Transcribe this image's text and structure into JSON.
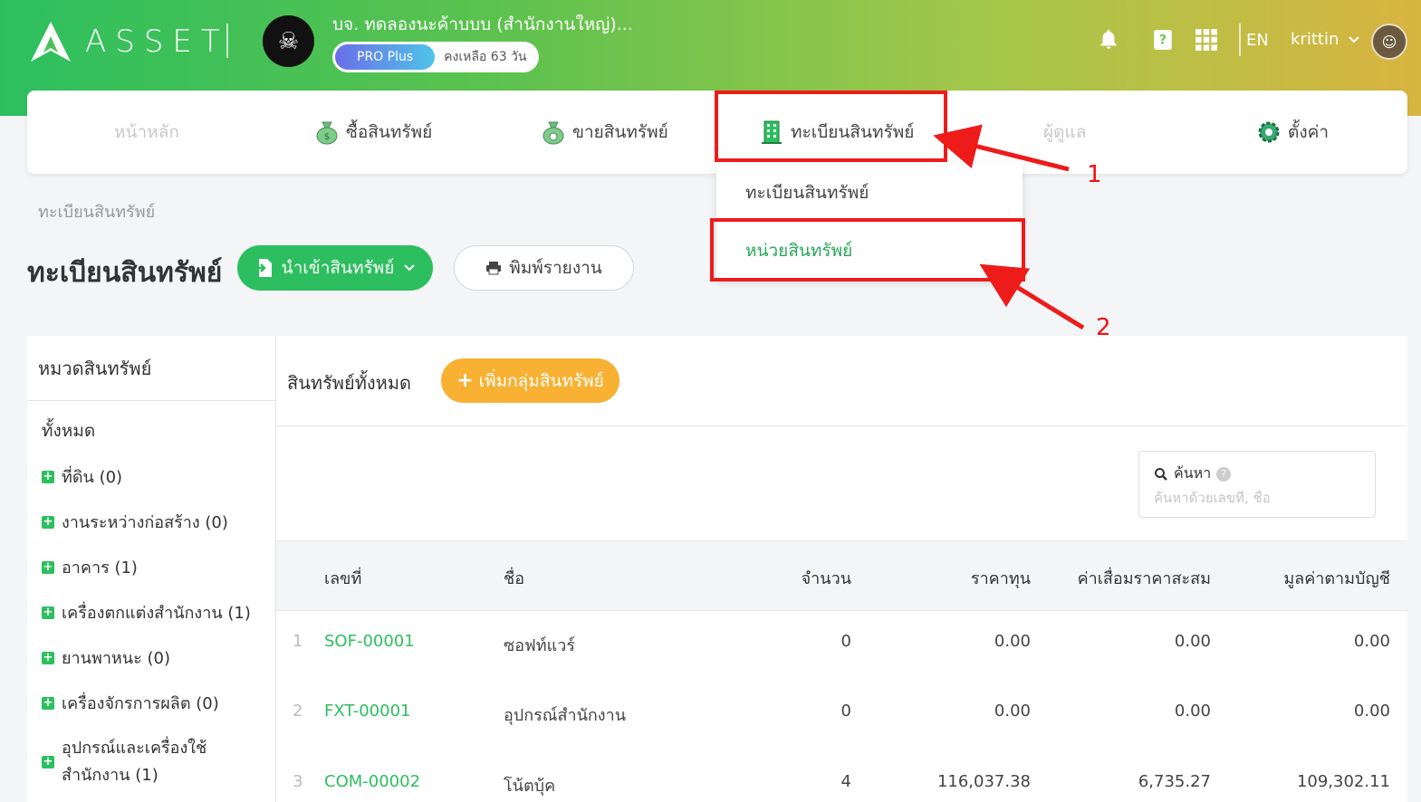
{
  "brand": {
    "logo_text": "ASSET"
  },
  "company": {
    "name": "บจ. ทดลองนะค้าบบบ (สำนักงานใหญ่)...",
    "plan": "PRO Plus",
    "remaining": "คงเหลือ 63 วัน"
  },
  "header": {
    "language": "EN",
    "username": "krittin"
  },
  "nav": {
    "home": "หน้าหลัก",
    "buy": "ซื้อสินทรัพย์",
    "sell": "ขายสินทรัพย์",
    "register": "ทะเบียนสินทรัพย์",
    "admin": "ผู้ดูแล",
    "settings": "ตั้งค่า"
  },
  "dropdown": {
    "item1": "ทะเบียนสินทรัพย์",
    "item2": "หน่วยสินทรัพย์"
  },
  "annotations": {
    "label1": "1",
    "label2": "2",
    "color": "#ee1b1b"
  },
  "page": {
    "breadcrumb": "ทะเบียนสินทรัพย์",
    "title": "ทะเบียนสินทรัพย์",
    "import_button": "นำเข้าสินทรัพย์",
    "print_button": "พิมพ์รายงาน"
  },
  "categories": {
    "heading": "หมวดสินทรัพย์",
    "all": "ทั้งหมด",
    "items": [
      "ที่ดิน (0)",
      "งานระหว่างก่อสร้าง (0)",
      "อาคาร (1)",
      "เครื่องตกแต่งสำนักงาน (1)",
      "ยานพาหนะ (0)",
      "เครื่องจักรการผลิต (0)",
      "อุปกรณ์และเครื่องใช้สำนักงาน (1)"
    ]
  },
  "assets": {
    "title": "สินทรัพย์ทั้งหมด",
    "add_group_button": "เพิ่มกลุ่มสินทรัพย์",
    "search_label": "ค้นหา",
    "search_placeholder": "ค้นหาด้วยเลขที่, ชื่อ",
    "columns": [
      "เลขที่",
      "ชื่อ",
      "จำนวน",
      "ราคาทุน",
      "ค่าเสื่อมราคาสะสม",
      "มูลค่าตามบัญชี"
    ],
    "rows": [
      {
        "idx": "1",
        "code": "SOF-00001",
        "name": "ซอฟท์แวร์",
        "qty": "0",
        "cost": "0.00",
        "dep": "0.00",
        "book": "0.00"
      },
      {
        "idx": "2",
        "code": "FXT-00001",
        "name": "อุปกรณ์สำนักงาน",
        "qty": "0",
        "cost": "0.00",
        "dep": "0.00",
        "book": "0.00"
      },
      {
        "idx": "3",
        "code": "COM-00002",
        "name": "โน้ตบุ้ค",
        "qty": "4",
        "cost": "116,037.38",
        "dep": "6,735.27",
        "book": "109,302.11"
      }
    ]
  },
  "colors": {
    "primary": "#2dbf5f",
    "accent": "#f8b133",
    "highlight": "#ee1b1b"
  }
}
